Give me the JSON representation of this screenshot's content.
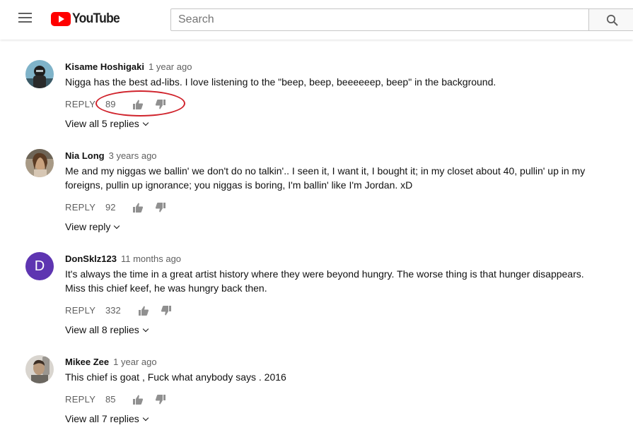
{
  "header": {
    "logo_text": "YouTube",
    "search_placeholder": "Search"
  },
  "comments": [
    {
      "author": "Kisame Hoshigaki",
      "time": "1 year ago",
      "text": "Nigga has the best ad-libs. I love listening to the \"beep, beep, beeeeeep, beep\" in the background.",
      "reply_label": "REPLY",
      "likes": "89",
      "replies_label": "View all 5 replies"
    },
    {
      "author": "Nia Long",
      "time": "3 years ago",
      "text": "Me and my niggas we ballin' we don't do no talkin'.. I seen it, I want it, I bought it; in my closet about 40, pullin' up in my foreigns, pullin up ignorance; you niggas is boring, I'm ballin' like I'm Jordan. xD",
      "reply_label": "REPLY",
      "likes": "92",
      "replies_label": "View reply"
    },
    {
      "author": "DonSklz123",
      "time": "11 months ago",
      "avatar_letter": "D",
      "text": "It's always the time in a great artist history where they were beyond hungry. The worse thing is that hunger disappears. Miss this chief keef, he was hungry back then.",
      "reply_label": "REPLY",
      "likes": "332",
      "replies_label": "View all 8 replies"
    },
    {
      "author": "Mikee Zee",
      "time": "1 year ago",
      "text": "This chief is goat , Fuck what anybody says . 2016",
      "reply_label": "REPLY",
      "likes": "85",
      "replies_label": "View all 7 replies"
    }
  ],
  "colors": {
    "brand_red": "#ff0000",
    "annotation_red": "#d0232c",
    "avatar_purple": "#5e35b1"
  }
}
